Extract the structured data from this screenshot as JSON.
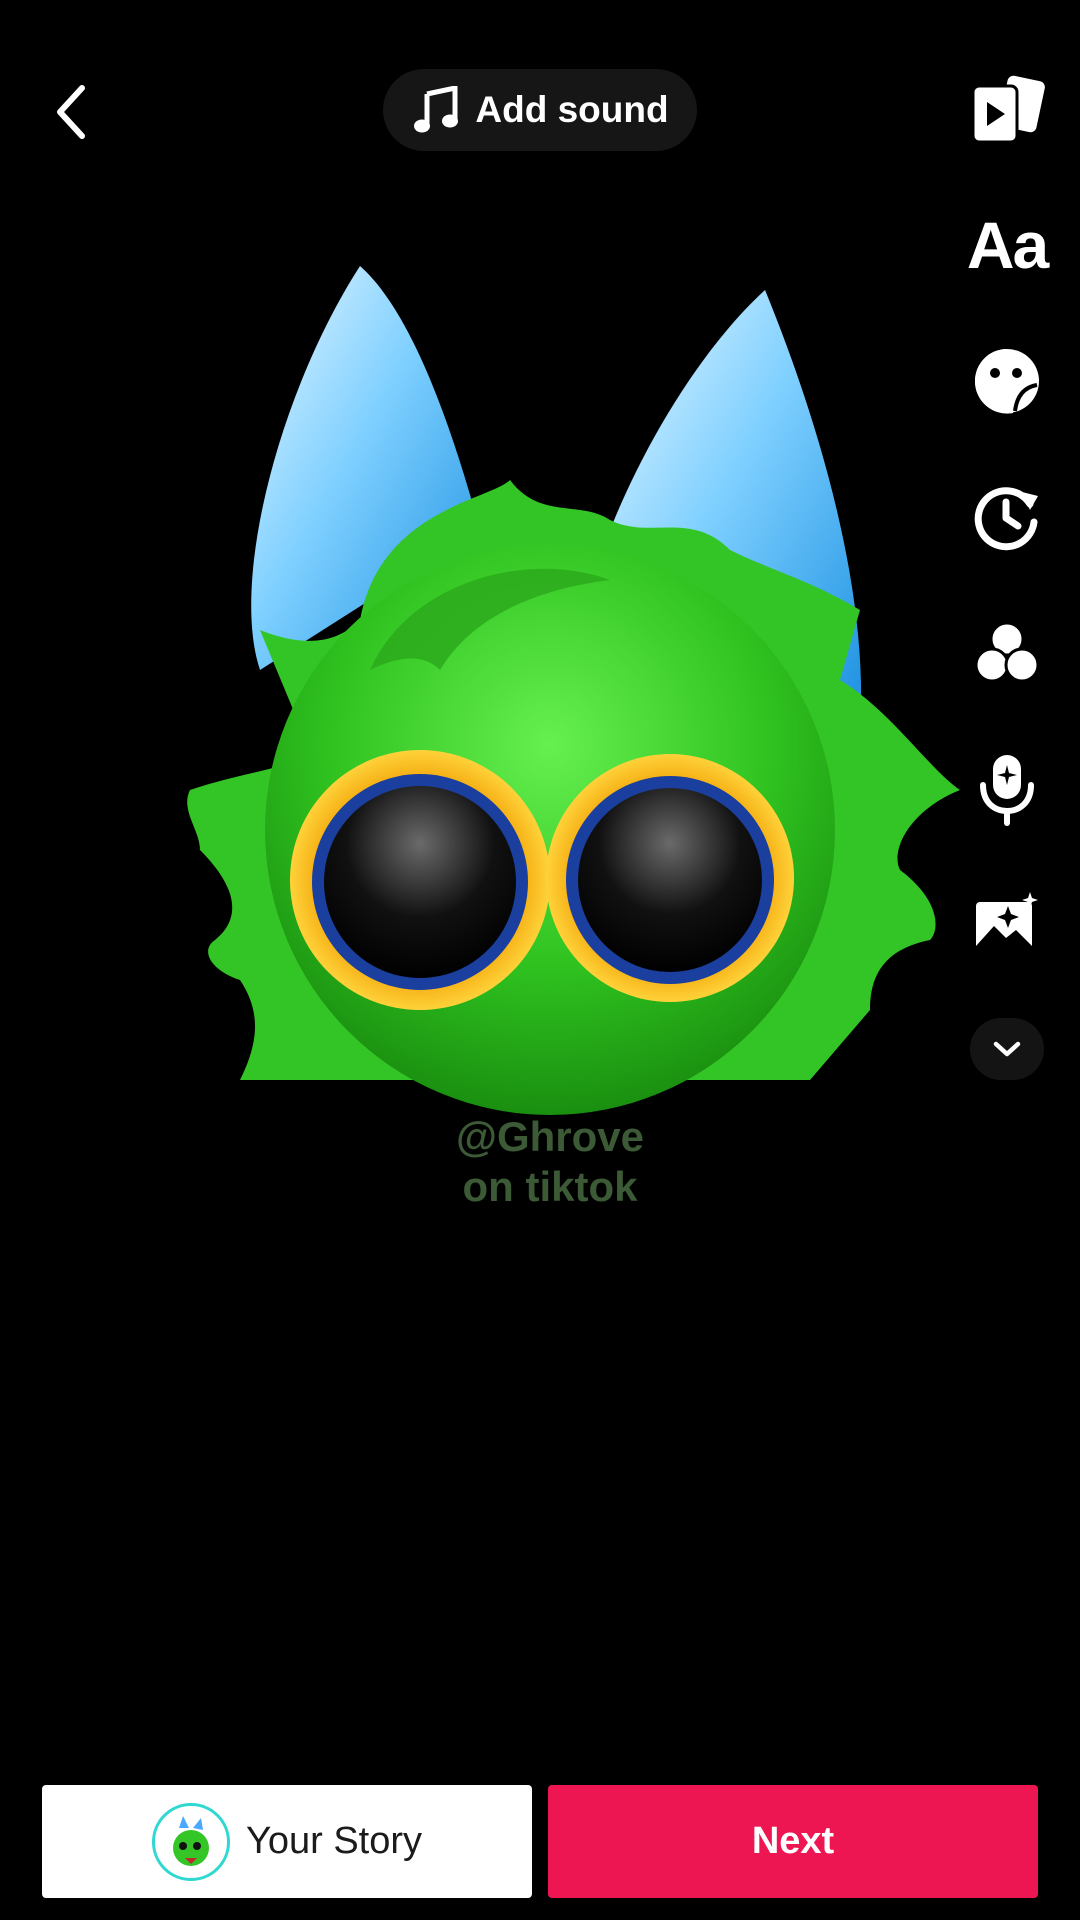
{
  "header": {
    "back_icon": "chevron-left-icon",
    "add_sound": {
      "icon": "music-note-icon",
      "label": "Add sound"
    }
  },
  "toolbar": {
    "items": [
      {
        "name": "templates",
        "icon": "template-cards-icon"
      },
      {
        "name": "text",
        "label": "Aa",
        "icon": "text-icon"
      },
      {
        "name": "stickers",
        "icon": "sticker-icon"
      },
      {
        "name": "effects",
        "icon": "effects-clock-icon"
      },
      {
        "name": "filters",
        "icon": "filters-icon"
      },
      {
        "name": "voice-effects",
        "icon": "microphone-sparkle-icon"
      },
      {
        "name": "enhance",
        "icon": "image-sparkle-icon"
      },
      {
        "name": "more",
        "icon": "chevron-down-icon"
      }
    ]
  },
  "media": {
    "description_icon": "green-creature-emoji",
    "watermark_line1": "@Ghrove",
    "watermark_line2": "on tiktok"
  },
  "footer": {
    "your_story_label": "Your Story",
    "next_label": "Next"
  },
  "colors": {
    "background": "#000000",
    "accent": "#ee1652",
    "pill": "#161616"
  }
}
